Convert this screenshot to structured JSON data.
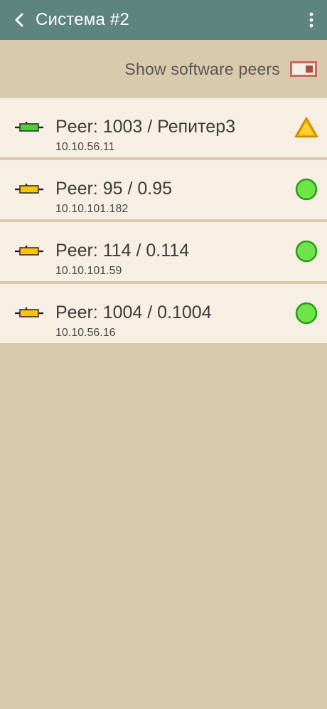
{
  "header": {
    "title": "Система #2"
  },
  "settings": {
    "show_software_peers_label": "Show software peers",
    "show_software_peers_enabled": true
  },
  "peers": [
    {
      "title": "Peer: 1003 / Репитер3",
      "ip": "10.10.56.11",
      "device_color": "#4cd137",
      "status": "warning",
      "status_color": "#f5b800"
    },
    {
      "title": "Peer: 95 / 0.95",
      "ip": "10.10.101.182",
      "device_color": "#ffc300",
      "status": "online",
      "status_color": "#6fe34a"
    },
    {
      "title": "Peer: 114 / 0.114",
      "ip": "10.10.101.59",
      "device_color": "#ffc300",
      "status": "online",
      "status_color": "#6fe34a"
    },
    {
      "title": "Peer: 1004 / 0.1004",
      "ip": "10.10.56.16",
      "device_color": "#ffc300",
      "status": "online",
      "status_color": "#6fe34a"
    }
  ],
  "icons": {
    "back": "back-arrow-icon",
    "menu": "more-vertical-icon",
    "peer_device": "peer-device-icon",
    "warning": "warning-triangle-icon",
    "online": "online-circle-icon"
  }
}
